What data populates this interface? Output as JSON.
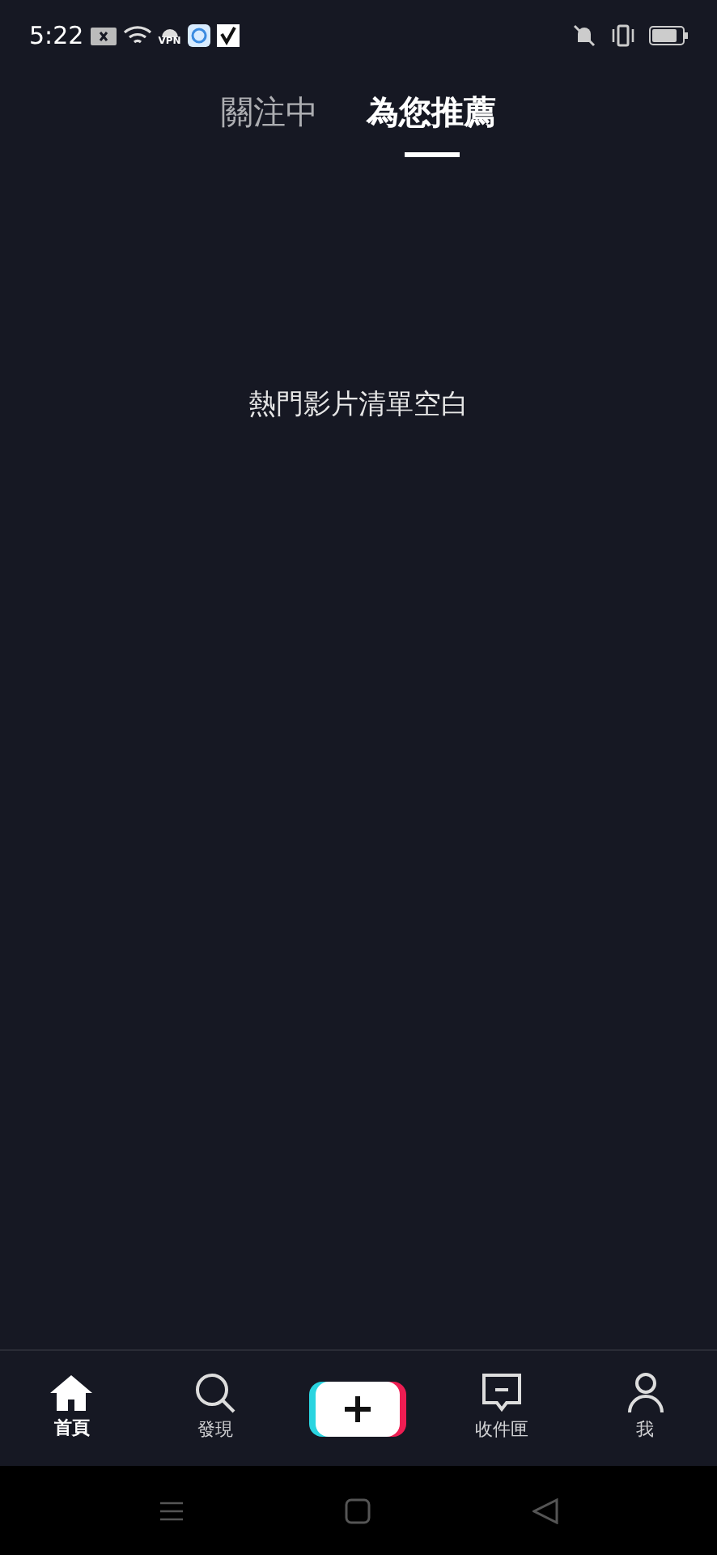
{
  "status_bar": {
    "time": "5:22",
    "vpn_label": "VPN"
  },
  "tabs": [
    {
      "label": "關注中",
      "selected": false
    },
    {
      "label": "為您推薦",
      "selected": true
    }
  ],
  "empty_message": "熱門影片清單空白",
  "bottom_nav": [
    {
      "kind": "home",
      "label": "首頁",
      "selected": true
    },
    {
      "kind": "discover",
      "label": "發現",
      "selected": false
    },
    {
      "kind": "create"
    },
    {
      "kind": "inbox",
      "label": "收件匣",
      "selected": false
    },
    {
      "kind": "profile",
      "label": "我",
      "selected": false
    }
  ]
}
